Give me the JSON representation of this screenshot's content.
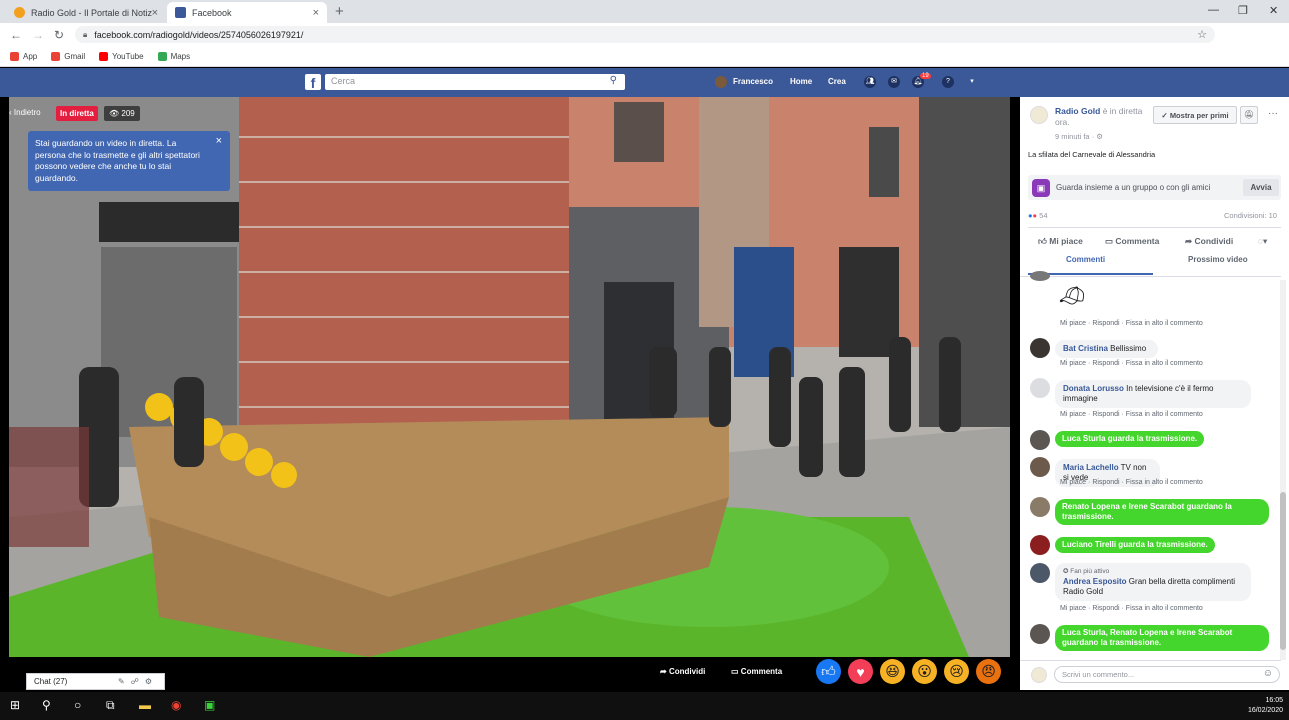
{
  "browser": {
    "tabs": [
      {
        "title": "Radio Gold - Il Portale di Notizie",
        "favicon_color": "#f2a01e",
        "active": false
      },
      {
        "title": "Facebook",
        "favicon_color": "#3b5998",
        "active": true
      }
    ],
    "url": "facebook.com/radiogold/videos/2574056026197921/",
    "bookmarks": [
      {
        "label": "App",
        "color": "#e94235"
      },
      {
        "label": "Gmail",
        "color": "#ea4335"
      },
      {
        "label": "YouTube",
        "color": "#ff0000"
      },
      {
        "label": "Maps",
        "color": "#34a853"
      }
    ]
  },
  "facebook": {
    "search_placeholder": "Cerca",
    "user": "Francesco",
    "nav": [
      "Home",
      "Crea"
    ],
    "notifications": "19"
  },
  "video": {
    "back_label": "Indietro",
    "live_label": "In diretta",
    "viewers": "209",
    "tooltip": "Stai guardando un video in diretta. La persona che lo trasmette e gli altri spettatori possono vedere che anche tu lo stai guardando.",
    "share_label": "Condividi",
    "comment_label": "Commenta",
    "chat_label": "Chat (27)"
  },
  "sidebar": {
    "page_name": "Radio Gold",
    "live_status": " è in diretta ora.",
    "time_ago": "9 minuti fa",
    "follow_label": "Mostra per primi",
    "description": "La sfilata del Carnevale di Alessandria",
    "watch_party": "Guarda insieme a un gruppo o con gli amici",
    "watch_start": "Avvia",
    "reactions_count": "54",
    "shares": "Condivisioni: 10",
    "actions": [
      "Mi piace",
      "Commenta",
      "Condividi"
    ],
    "tabs": [
      "Commenti",
      "Prossimo video"
    ],
    "comment_placeholder": "Scrivi un commento...",
    "meta": {
      "like": "Mi piace",
      "reply": "Rispondi",
      "pin": "Fissa in alto il commento"
    },
    "top_fan": "Fan più attivo",
    "comments": [
      {
        "author": "Bat Cristina",
        "text": " Bellissimo"
      },
      {
        "author": "Donata Lorusso",
        "text": " In televisione c'è il fermo immagine"
      },
      {
        "system": "Luca Sturla guarda la trasmissione."
      },
      {
        "author": "Maria Lachello",
        "text": " TV non si vede"
      },
      {
        "system": "Renato Lopena e Irene Scarabot guardano la trasmissione."
      },
      {
        "system": "Luciano Tirelli guarda la trasmissione."
      },
      {
        "author": "Andrea Esposito",
        "text": " Gran bella diretta complimenti Radio Gold"
      },
      {
        "system": "Luca Sturla, Renato Lopena e Irene Scarabot guardano la trasmissione."
      }
    ]
  },
  "taskbar": {
    "time": "16:05",
    "date": "16/02/2020"
  }
}
